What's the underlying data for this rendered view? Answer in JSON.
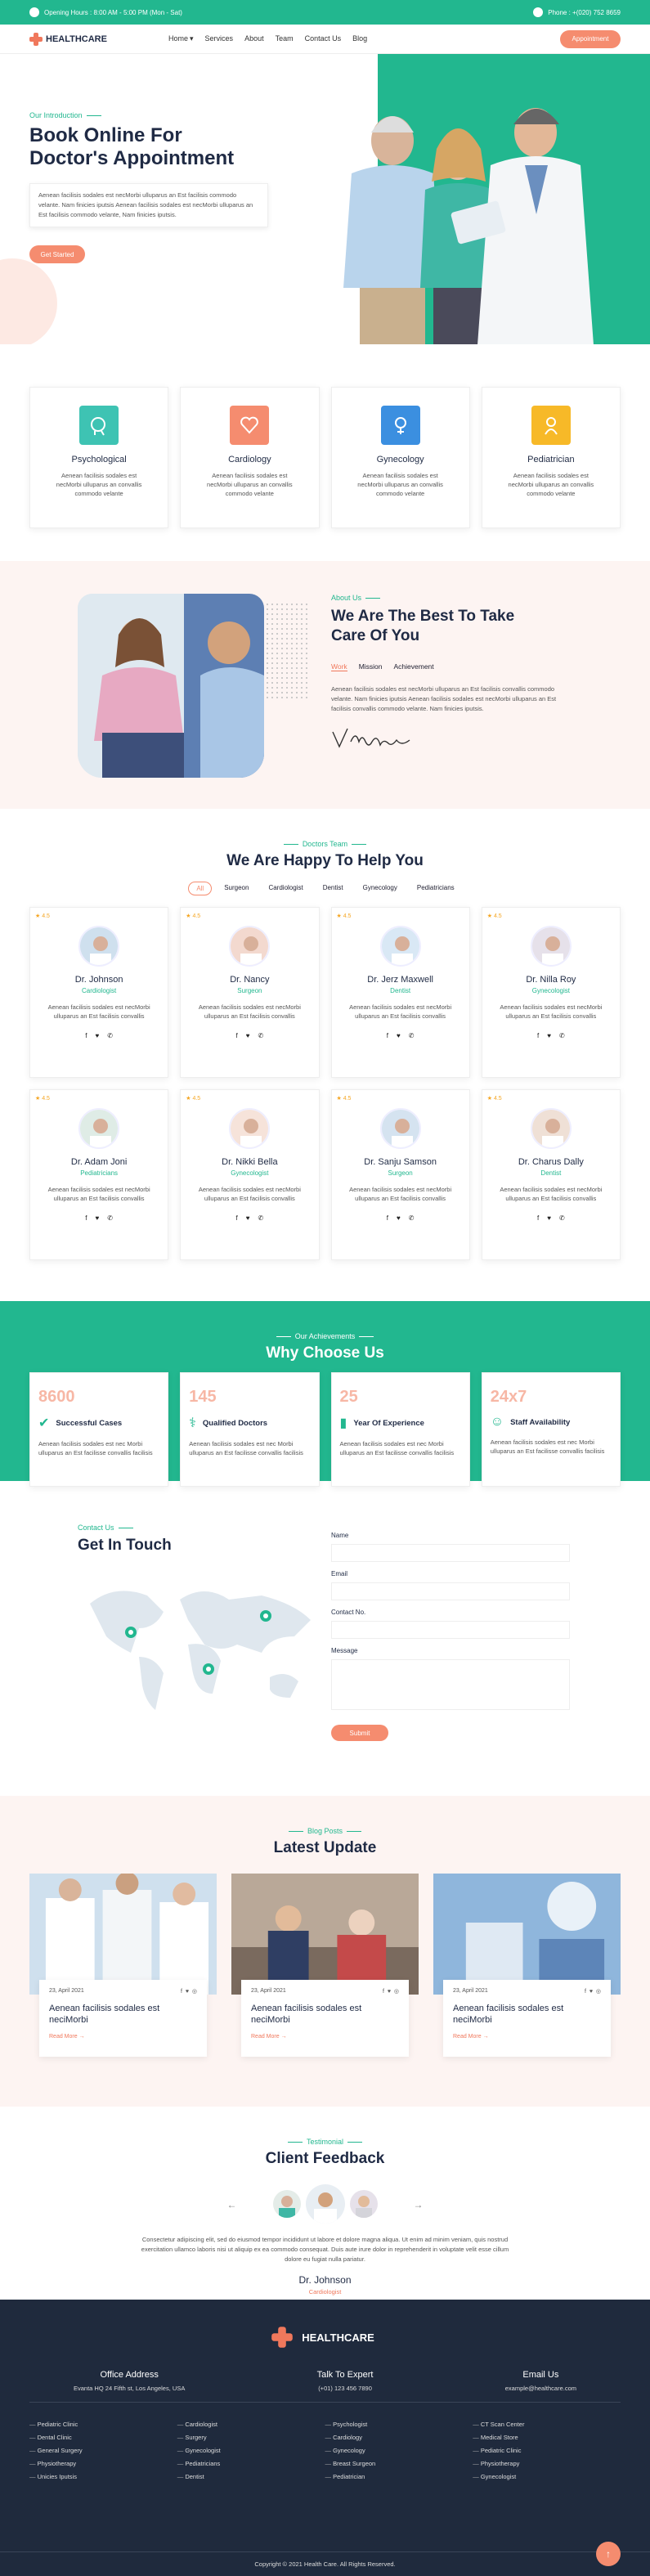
{
  "topbar": {
    "hours": "Opening Hours : 8:00 AM - 5:00 PM (Mon - Sat)",
    "phone": "Phone : +(020) 752 8659"
  },
  "brand": {
    "name": "HEALTHCARE",
    "accent": "#22b78f",
    "orange": "#f58c6f"
  },
  "nav": {
    "items": [
      "Home",
      "Services",
      "About",
      "Team",
      "Contact Us",
      "Blog"
    ],
    "cta": "Appointment"
  },
  "hero": {
    "eyebrow": "Our Introduction",
    "title_l1": "Book Online For",
    "title_l2": "Doctor's Appointment",
    "text": "Aenean facilisis sodales est necMorbi ulluparus an Est facilisis commodo velante. Nam finicies iputsis Aenean facilisis sodales est necMorbi ulluparus an Est facilisis commodo velante, Nam finicies iputsis.",
    "button": "Get Started"
  },
  "services": [
    {
      "title": "Psychological",
      "text": "Aenean facilisis sodales est necMorbi ulluparus an convallis commodo velante"
    },
    {
      "title": "Cardiology",
      "text": "Aenean facilisis sodales est necMorbi ulluparus an convallis commodo velante"
    },
    {
      "title": "Gynecology",
      "text": "Aenean facilisis sodales est necMorbi ulluparus an convallis commodo velante"
    },
    {
      "title": "Pediatrician",
      "text": "Aenean facilisis sodales est necMorbi ulluparus an convallis commodo velante"
    }
  ],
  "about": {
    "eyebrow": "About Us",
    "title_l1": "We Are The Best To Take",
    "title_l2": "Care Of You",
    "tabs": [
      "Work",
      "Mission",
      "Achievement"
    ],
    "text": "Aenean facilisis sodales est necMorbi ulluparus an Est facilisis convallis commodo velante. Nam finicies iputsis Aenean facilisis sodales est necMorbi ulluparus an Est facilisis convallis commodo velante. Nam finicies iputsis.",
    "signature": "V.Mukati"
  },
  "team": {
    "eyebrow": "Doctors Team",
    "title": "We Are Happy To Help You",
    "filters": [
      "All",
      "Surgeon",
      "Cardiologist",
      "Dentist",
      "Gynecology",
      "Pediatricians"
    ],
    "doctors": [
      {
        "name": "Dr. Johnson",
        "role": "Cardiologist"
      },
      {
        "name": "Dr. Nancy",
        "role": "Surgeon"
      },
      {
        "name": "Dr. Jerz Maxwell",
        "role": "Dentist"
      },
      {
        "name": "Dr. Nilla Roy",
        "role": "Gynecologist"
      },
      {
        "name": "Dr. Adam Joni",
        "role": "Pediatricians"
      },
      {
        "name": "Dr. Nikki Bella",
        "role": "Gynecologist"
      },
      {
        "name": "Dr. Sanju Samson",
        "role": "Surgeon"
      },
      {
        "name": "Dr. Charus Dally",
        "role": "Dentist"
      }
    ],
    "rating": "★ 4.5",
    "text": "Aenean facilisis sodales est necMorbi ulluparus an Est facilisis convallis"
  },
  "why": {
    "eyebrow": "Our Achievements",
    "title": "Why Choose Us",
    "stats": [
      {
        "num": "8600",
        "label": "Successful Cases"
      },
      {
        "num": "145",
        "label": "Qualified Doctors"
      },
      {
        "num": "25",
        "label": "Year Of Experience"
      },
      {
        "num": "24x7",
        "label": "Staff Availability"
      }
    ],
    "text": "Aenean facilisis sodales est nec Morbi ulluparus an Est facilisse convallis facilisis"
  },
  "contact": {
    "eyebrow": "Contact Us",
    "title": "Get In Touch",
    "labels": [
      "Name",
      "Email",
      "Contact No.",
      "Message"
    ],
    "button": "Submit"
  },
  "blog": {
    "eyebrow": "Blog Posts",
    "title": "Latest Update",
    "posts": [
      {
        "date": "23, April 2021",
        "title": "Aenean facilisis sodales est neciMorbi",
        "more": "Read More →"
      },
      {
        "date": "23, April 2021",
        "title": "Aenean facilisis sodales est neciMorbi",
        "more": "Read More →"
      },
      {
        "date": "23, April 2021",
        "title": "Aenean facilisis sodales est neciMorbi",
        "more": "Read More →"
      }
    ]
  },
  "testimonial": {
    "eyebrow": "Testimonial",
    "title": "Client Feedback",
    "quote": "Consectetur adipiscing elit, sed do eiusmod tempor incididunt ut labore et dolore magna aliqua. Ut enim ad minim veniam, quis nostrud exercitation ullamco laboris nisi ut aliquip ex ea commodo consequat. Duis aute irure dolor in reprehenderit in voluptate velit esse cillum dolore eu fugiat nulla pariatur.",
    "name": "Dr. Johnson",
    "role": "Cardiologist"
  },
  "footer": {
    "office_title": "Office Address",
    "office": "Evanta HQ 24 Fifth st, Los Angeles, USA",
    "talk_title": "Talk To Expert",
    "talk": "(+01) 123 456 7890",
    "email_title": "Email Us",
    "email": "example@healthcare.com",
    "col1": [
      "Pediatric Clinic",
      "Dental Clinic",
      "General Surgery",
      "Physiotherapy",
      "Unicies Iputsis"
    ],
    "col2": [
      "Cardiologist",
      "Surgery",
      "Gynecologist",
      "Pediatricians",
      "Dentist"
    ],
    "col3": [
      "Psychologist",
      "Cardiology",
      "Gynecology",
      "Breast Surgeon",
      "Pediatrician"
    ],
    "col4": [
      "CT Scan Center",
      "Medical Store",
      "Pediatric Clinic",
      "Physiotherapy",
      "Gynecologist"
    ],
    "copyright": "Copyright © 2021 Health Care. All Rights Reserved."
  }
}
